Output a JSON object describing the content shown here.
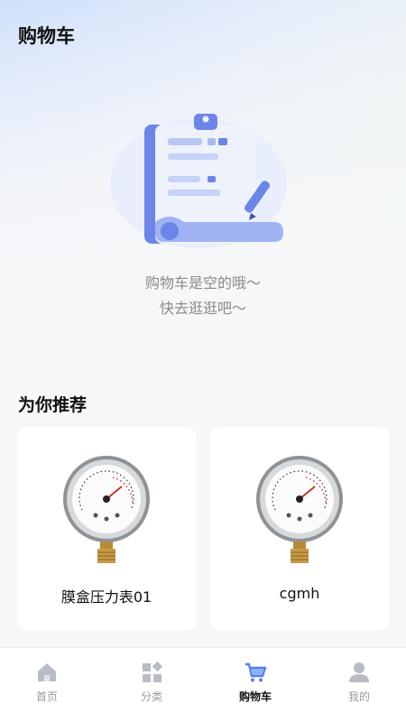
{
  "header": {
    "title": "购物车"
  },
  "empty_state": {
    "illustration": "clipboard-illustration",
    "line1": "购物车是空的哦～",
    "line2": "快去逛逛吧～"
  },
  "recommend": {
    "title": "为你推荐",
    "items": [
      {
        "name": "膜盒压力表01",
        "image": "pressure-gauge-image"
      },
      {
        "name": "cgmh",
        "image": "pressure-gauge-image"
      }
    ]
  },
  "tabbar": {
    "active": "cart",
    "items": [
      {
        "key": "home",
        "label": "首页",
        "icon": "home-icon"
      },
      {
        "key": "category",
        "label": "分类",
        "icon": "category-icon"
      },
      {
        "key": "cart",
        "label": "购物车",
        "icon": "cart-icon"
      },
      {
        "key": "mine",
        "label": "我的",
        "icon": "user-icon"
      }
    ]
  },
  "colors": {
    "accent": "#4f7ff0",
    "inactive_icon": "#b8bcc4",
    "text_primary": "#111111",
    "text_secondary": "#8a8a8a"
  }
}
